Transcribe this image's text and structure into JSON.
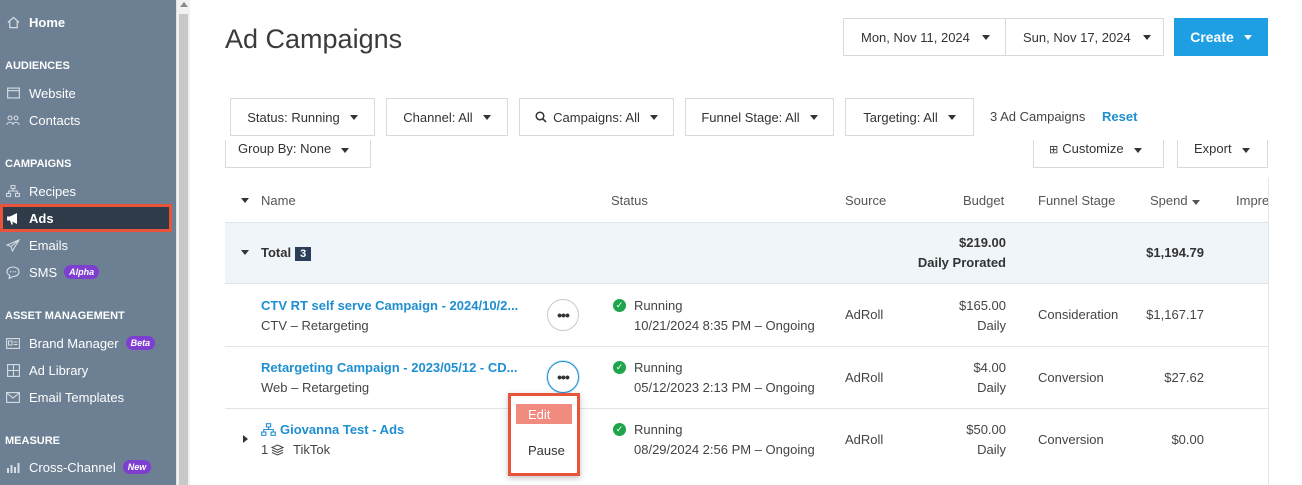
{
  "sidebar": {
    "home": "Home",
    "sections": {
      "audiences": "AUDIENCES",
      "campaigns": "CAMPAIGNS",
      "asset_management": "ASSET MANAGEMENT",
      "measure": "MEASURE"
    },
    "items": {
      "website": "Website",
      "contacts": "Contacts",
      "recipes": "Recipes",
      "ads": "Ads",
      "emails": "Emails",
      "sms": "SMS",
      "sms_badge": "Alpha",
      "brand_manager": "Brand Manager",
      "brand_manager_badge": "Beta",
      "ad_library": "Ad Library",
      "email_templates": "Email Templates",
      "cross_channel": "Cross-Channel",
      "cross_channel_badge": "New"
    }
  },
  "header": {
    "title": "Ad Campaigns",
    "start_date": "Mon, Nov 11, 2024",
    "end_date": "Sun, Nov 17, 2024",
    "create_label": "Create"
  },
  "filters": {
    "status": "Status: Running",
    "channel": "Channel: All",
    "campaigns": "Campaigns: All",
    "funnel_stage": "Funnel Stage: All",
    "targeting": "Targeting: All",
    "count": "3 Ad Campaigns",
    "reset": "Reset",
    "group_by": "Group By: None",
    "customize": "Customize",
    "export": "Export"
  },
  "table": {
    "columns": {
      "name": "Name",
      "status": "Status",
      "source": "Source",
      "budget": "Budget",
      "funnel_stage": "Funnel Stage",
      "spend": "Spend",
      "impressions": "Impre"
    },
    "total": {
      "label": "Total",
      "count": "3",
      "budget": "$219.00",
      "budget_sub": "Daily Prorated",
      "spend": "$1,194.79"
    },
    "rows": [
      {
        "name": "CTV RT self serve Campaign - 2024/10/2...",
        "sub": "CTV – Retargeting",
        "status": "Running",
        "status_sub": "10/21/2024 8:35 PM – Ongoing",
        "source": "AdRoll",
        "budget": "$165.00",
        "budget_sub": "Daily",
        "funnel_stage": "Consideration",
        "spend": "$1,167.17"
      },
      {
        "name": "Retargeting Campaign - 2023/05/12 - CD...",
        "sub": "Web – Retargeting",
        "status": "Running",
        "status_sub": "05/12/2023 2:13 PM – Ongoing",
        "source": "AdRoll",
        "budget": "$4.00",
        "budget_sub": "Daily",
        "funnel_stage": "Conversion",
        "spend": "$27.62"
      },
      {
        "name": "Giovanna Test - Ads",
        "sub_count": "1",
        "sub": "TikTok",
        "status": "Running",
        "status_sub": "08/29/2024 2:56 PM – Ongoing",
        "source": "AdRoll",
        "budget": "$50.00",
        "budget_sub": "Daily",
        "funnel_stage": "Conversion",
        "spend": "$0.00"
      }
    ]
  },
  "menu": {
    "edit": "Edit",
    "pause": "Pause"
  },
  "colors": {
    "sidebar_bg": "#6c7f93",
    "accent": "#1e9fe3",
    "highlight": "#e8533b",
    "success": "#1ea44b"
  }
}
